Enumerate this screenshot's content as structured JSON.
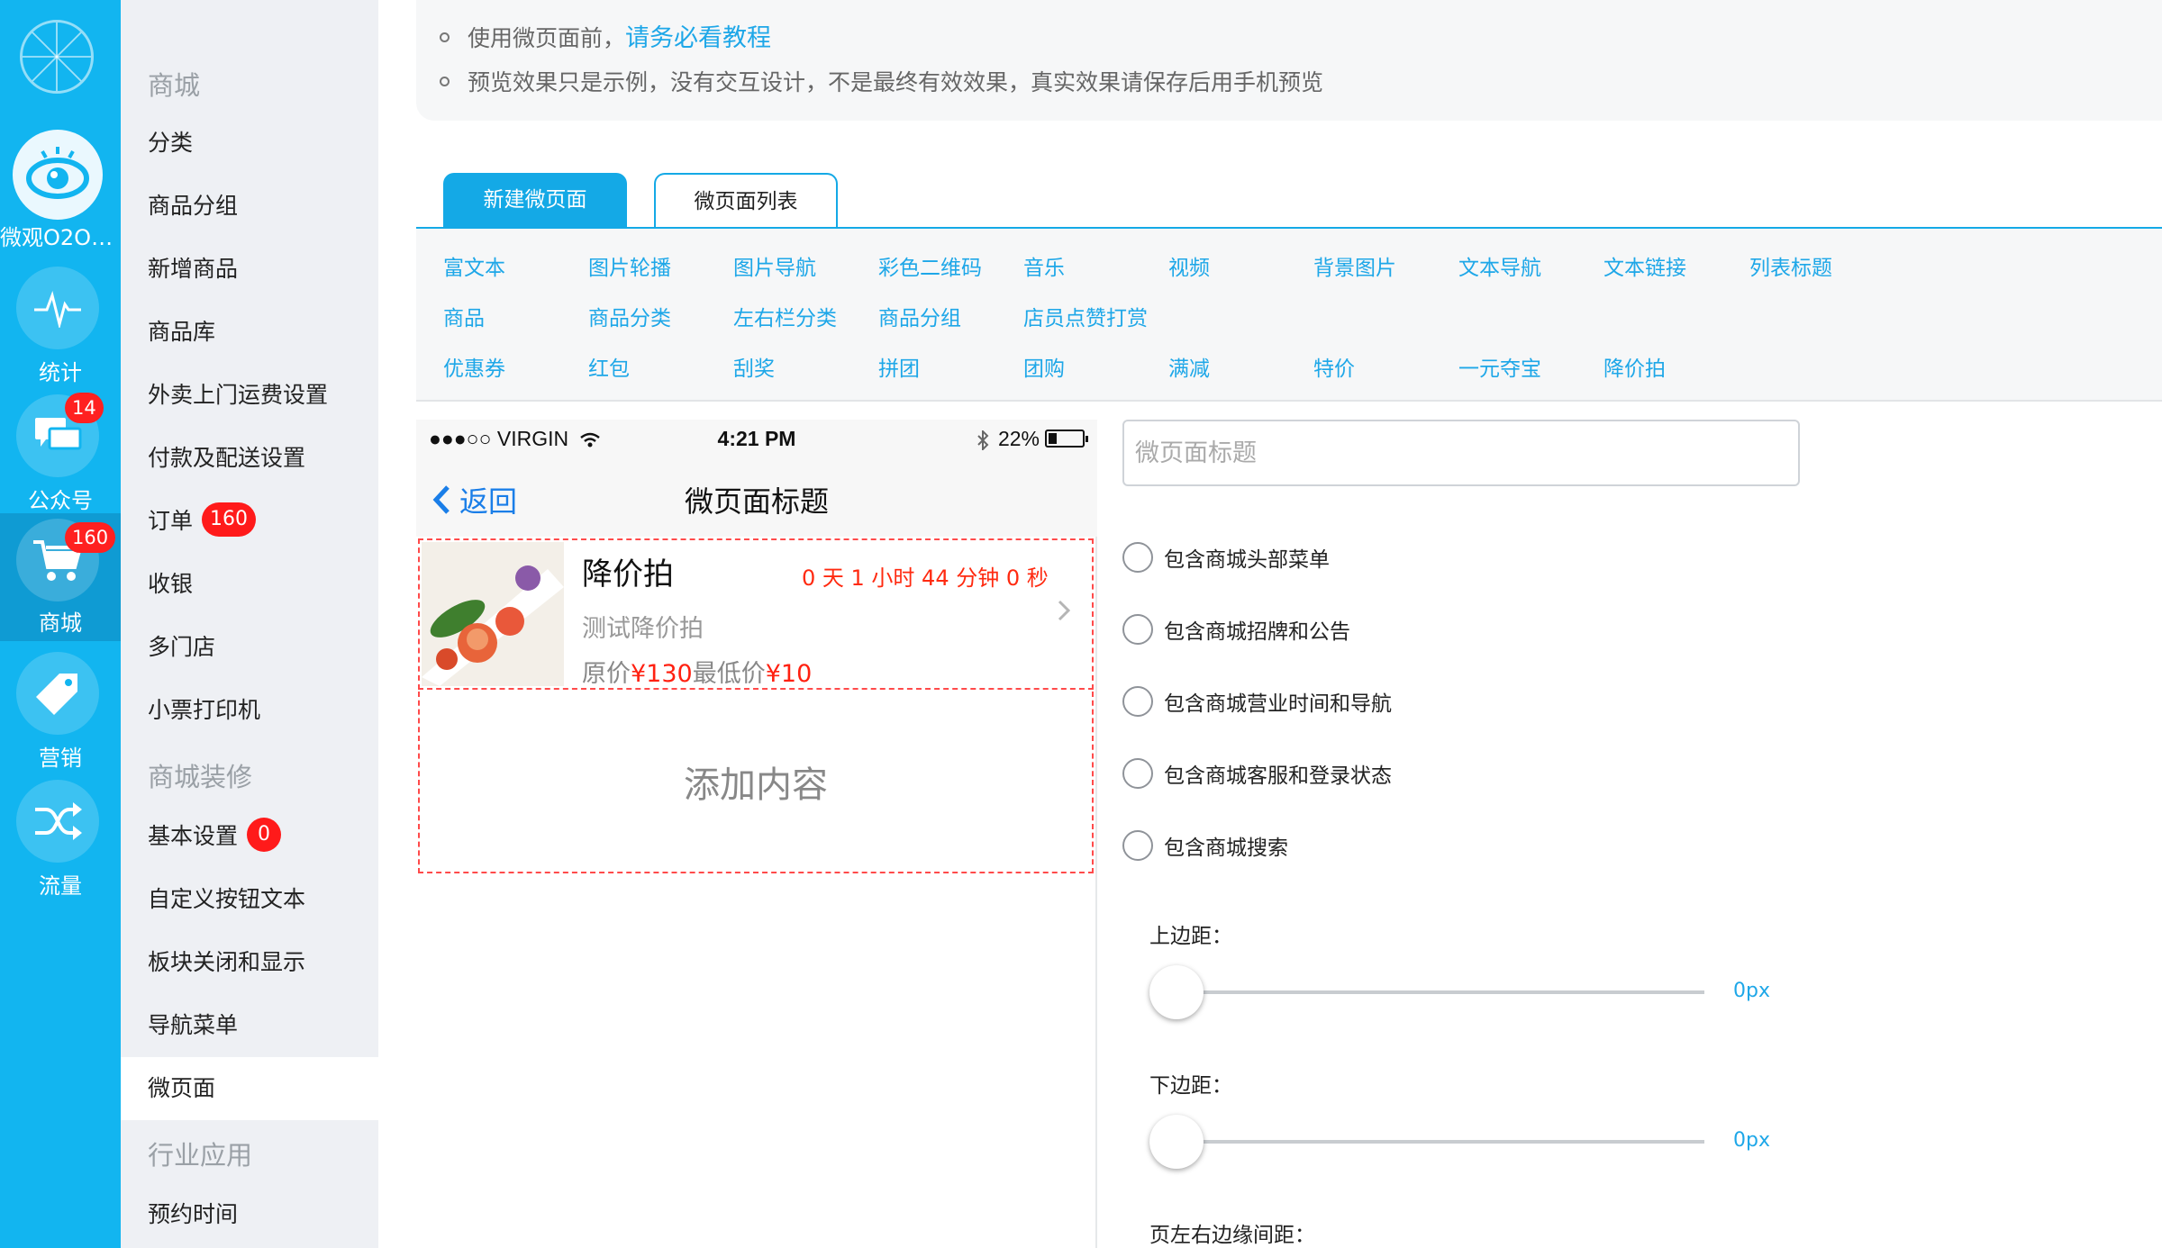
{
  "rail": {
    "items": [
      {
        "label": "微观O2O商..."
      },
      {
        "label": "统计"
      },
      {
        "label": "公众号",
        "badge": "14"
      },
      {
        "label": "商城",
        "badge": "160"
      },
      {
        "label": "营销"
      },
      {
        "label": "流量"
      }
    ]
  },
  "sidebar": {
    "sections": [
      "商城",
      "商城装修",
      "行业应用"
    ],
    "items": [
      {
        "label": "分类"
      },
      {
        "label": "商品分组"
      },
      {
        "label": "新增商品"
      },
      {
        "label": "商品库"
      },
      {
        "label": "外卖上门运费设置"
      },
      {
        "label": "付款及配送设置"
      },
      {
        "label": "订单",
        "badge": "160"
      },
      {
        "label": "收银"
      },
      {
        "label": "多门店"
      },
      {
        "label": "小票打印机"
      },
      {
        "label": "基本设置",
        "badge": "0"
      },
      {
        "label": "自定义按钮文本"
      },
      {
        "label": "板块关闭和显示"
      },
      {
        "label": "导航菜单"
      },
      {
        "label": "微页面"
      },
      {
        "label": "预约时间"
      }
    ]
  },
  "notice": {
    "line1_prefix": "使用微页面前，",
    "line1_link": "请务必看教程",
    "line2": "预览效果只是示例，没有交互设计，不是最终有效效果，真实效果请保存后用手机预览"
  },
  "tabs": {
    "new": "新建微页面",
    "list": "微页面列表"
  },
  "widgets": [
    [
      "富文本",
      "图片轮播",
      "图片导航",
      "彩色二维码",
      "音乐",
      "视频",
      "背景图片",
      "文本导航",
      "文本链接",
      "列表标题"
    ],
    [
      "商品",
      "商品分类",
      "左右栏分类",
      "商品分组",
      "店员点赞打赏"
    ],
    [
      "优惠券",
      "红包",
      "刮奖",
      "拼团",
      "团购",
      "满减",
      "特价",
      "一元夺宝",
      "降价拍"
    ]
  ],
  "phone": {
    "carrier": "●●●○○ VIRGIN",
    "time": "4:21 PM",
    "battery": "22%",
    "back": "返回",
    "title": "微页面标题"
  },
  "product": {
    "name": "降价拍",
    "countdown": "0 天 1 小时 44 分钟 0 秒",
    "subtitle": "测试降价拍",
    "orig_label": "原价",
    "orig_price": "¥130",
    "min_label": "最低价",
    "min_price": "¥10"
  },
  "add_content": "添加内容",
  "settings": {
    "title_placeholder": "微页面标题",
    "options": [
      "包含商城头部菜单",
      "包含商城招牌和公告",
      "包含商城营业时间和导航",
      "包含商城客服和登录状态",
      "包含商城搜索"
    ],
    "top_margin_label": "上边距：",
    "top_margin_value": "0px",
    "bottom_margin_label": "下边距：",
    "bottom_margin_value": "0px",
    "side_margin_label": "页左右边缘间距："
  }
}
